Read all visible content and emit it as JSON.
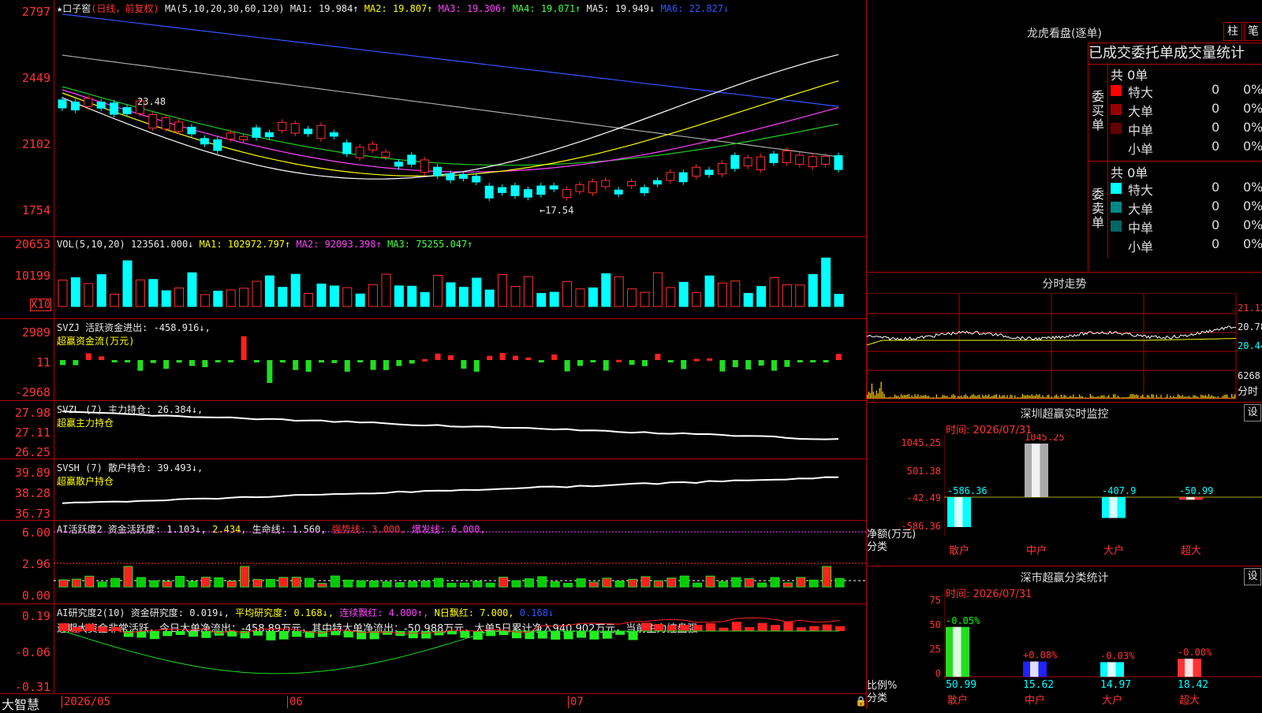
{
  "price_panel": {
    "y_ticks": [
      "2797",
      "2449",
      "2102",
      "1754"
    ],
    "title": "口子窖",
    "mode": "(日线，前复权)",
    "ma_label": "MA(5,10,20,30,60,120)",
    "ma1": "MA1: 19.984↑",
    "ma2": "MA2: 19.807↑",
    "ma3": "MA3: 19.306↑",
    "ma4": "MA4: 19.071↑",
    "ma5": "MA5: 19.949↓",
    "ma6": "MA6: 22.827↓",
    "high_label": "23.48",
    "low_label": "←17.54"
  },
  "vol_panel": {
    "y_ticks": [
      "20653",
      "10199"
    ],
    "unit": "X10",
    "label": "VOL(5,10,20)",
    "value": "123561.000↓",
    "ma1": "MA1: 102972.797↑",
    "ma2": "MA2: 92093.398↑",
    "ma3": "MA3: 75255.047↑"
  },
  "svzj_panel": {
    "y_ticks": [
      "2989",
      "11",
      "-2968"
    ],
    "label": "SVZJ  活跃资金进出: -458.916↓,",
    "subtitle": "超赢资金流(万元)"
  },
  "svzl_panel": {
    "y_ticks": [
      "27.98",
      "27.11",
      "26.25"
    ],
    "label": "SVZL (7) 主力持仓: 26.384↓,",
    "subtitle": "超赢主力持仓"
  },
  "svsh_panel": {
    "y_ticks": [
      "39.89",
      "38.28",
      "36.73"
    ],
    "label": "SVSH (7) 散户持仓: 39.493↓,",
    "subtitle": "超赢散户持仓"
  },
  "ai_active_panel": {
    "y_ticks": [
      "6.00",
      "2.96",
      "0.00"
    ],
    "label": "AI活跃度2 资金活跃度: 1.103↓,",
    "v2": "2.434,",
    "life": "生命线: 1.560,",
    "strong": "强势线: 3.000,",
    "burst": "爆发线: 6.000,"
  },
  "ai_research_panel": {
    "y_ticks": [
      "0.19",
      "-0.06",
      "-0.31"
    ],
    "label": "AI研究度2(10) 资金研究度: 0.019↓,",
    "avg": "平均研究度: 0.168↓,",
    "red": "连续飘红: 4.000↑,",
    "nred": "N日飘红: 7.000,",
    "v": "0.168↓",
    "comment": "近期大资金非常活跃，今日大单净流出：-458.89万元，其中特大单净流出：-50.988万元，大单5日累计净入940.902万元，当前主力控盘强"
  },
  "bottom_axis": {
    "app": "大智慧",
    "d1": "2026/05",
    "d2": "06",
    "d3": "07"
  },
  "longhu": {
    "title": "龙虎看盘(逐单)",
    "btn_zhu": "柱",
    "btn_bi": "笔",
    "subtitle": "已成交委托单成交量统计",
    "buy_side": "委买单",
    "sell_side": "委卖单",
    "buy_total": "共 0单",
    "sell_total": "共 0单",
    "buy_rows": [
      {
        "name": "特大",
        "count": "0",
        "pct": "0%",
        "color": "#ff0000"
      },
      {
        "name": "大单",
        "count": "0",
        "pct": "0%",
        "color": "#990000"
      },
      {
        "name": "中单",
        "count": "0",
        "pct": "0%",
        "color": "#660000"
      },
      {
        "name": "小单",
        "count": "0",
        "pct": "0%",
        "color": "#000000"
      }
    ],
    "sell_rows": [
      {
        "name": "特大",
        "count": "0",
        "pct": "0%",
        "color": "#00ffff"
      },
      {
        "name": "大单",
        "count": "0",
        "pct": "0%",
        "color": "#008888"
      },
      {
        "name": "中单",
        "count": "0",
        "pct": "0%",
        "color": "#006666"
      },
      {
        "name": "小单",
        "count": "0",
        "pct": "0%",
        "color": "#000000"
      }
    ]
  },
  "intraday": {
    "title": "分时走势",
    "p1": "21.12",
    "p2": "20.78",
    "p3": "20.44",
    "vol": "6268",
    "unit": "分时"
  },
  "monitor": {
    "title": "深圳超赢实时监控",
    "set": "设",
    "time": "时间: 2026/07/31",
    "y_ticks": [
      "1045.25",
      "501.38",
      "-42.49",
      "-586.36"
    ],
    "net_label": "净额(万元)",
    "cat_label": "分类",
    "categories": [
      "散户",
      "中户",
      "大户",
      "超大"
    ],
    "values": [
      -586.36,
      1045.25,
      -407.9,
      -50.99
    ],
    "value_labels": [
      "-586.36",
      "1045.25",
      "-407.9",
      "-50.99"
    ]
  },
  "classify": {
    "title": "深市超赢分类统计",
    "set": "设",
    "time": "时间: 2026/07/31",
    "y_ticks": [
      "75",
      "50",
      "25",
      "0"
    ],
    "ratio_label": "比例%",
    "cat_label": "分类",
    "categories": [
      "散户",
      "中户",
      "大户",
      "超大"
    ],
    "values": [
      50.99,
      15.62,
      14.97,
      18.42
    ],
    "changes": [
      "-0.05%",
      "+0.08%",
      "-0.03%",
      "-0.00%"
    ],
    "value_labels": [
      "50.99",
      "15.62",
      "14.97",
      "18.42"
    ]
  },
  "colors": {
    "up": "#ff3030",
    "down": "#00ffff",
    "grid": "#b00000"
  }
}
